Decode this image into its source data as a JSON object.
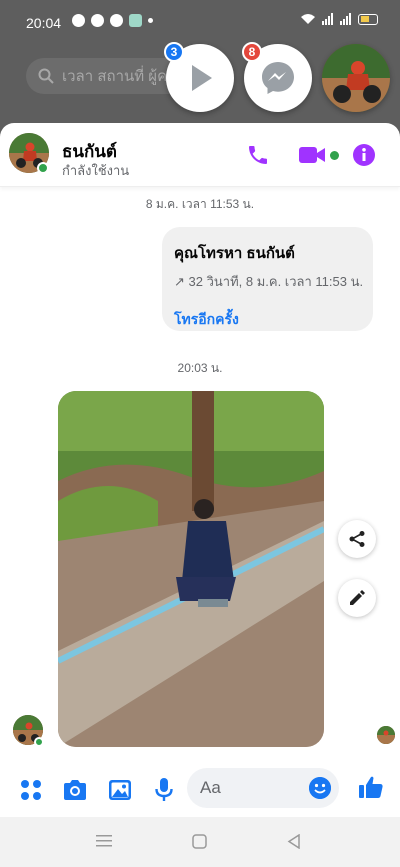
{
  "status_bar": {
    "time": "20:04"
  },
  "background": {
    "search_placeholder": "เวลา สถานที่ ผู้ค"
  },
  "chat_heads": [
    {
      "badge": "3",
      "icon": "play-icon",
      "color": "#1877f2"
    },
    {
      "badge": "8",
      "icon": "messenger-icon",
      "color": "#e4473c"
    },
    {
      "icon": "avatar-photo"
    }
  ],
  "header": {
    "name": "ธนกันต์",
    "status": "กำลังใช้งาน",
    "accent": "#a033ff"
  },
  "messages": {
    "timestamp1": "8 ม.ค. เวลา 11:53 น.",
    "call": {
      "title": "คุณโทรหา ธนกันต์",
      "detail": "↗ 32 วินาที, 8 ม.ค. เวลา 11:53 น.",
      "action": "โทรอีกครั้ง"
    },
    "timestamp2": "20:03 น."
  },
  "composer": {
    "placeholder": "Aa",
    "accent": "#1877f2"
  }
}
